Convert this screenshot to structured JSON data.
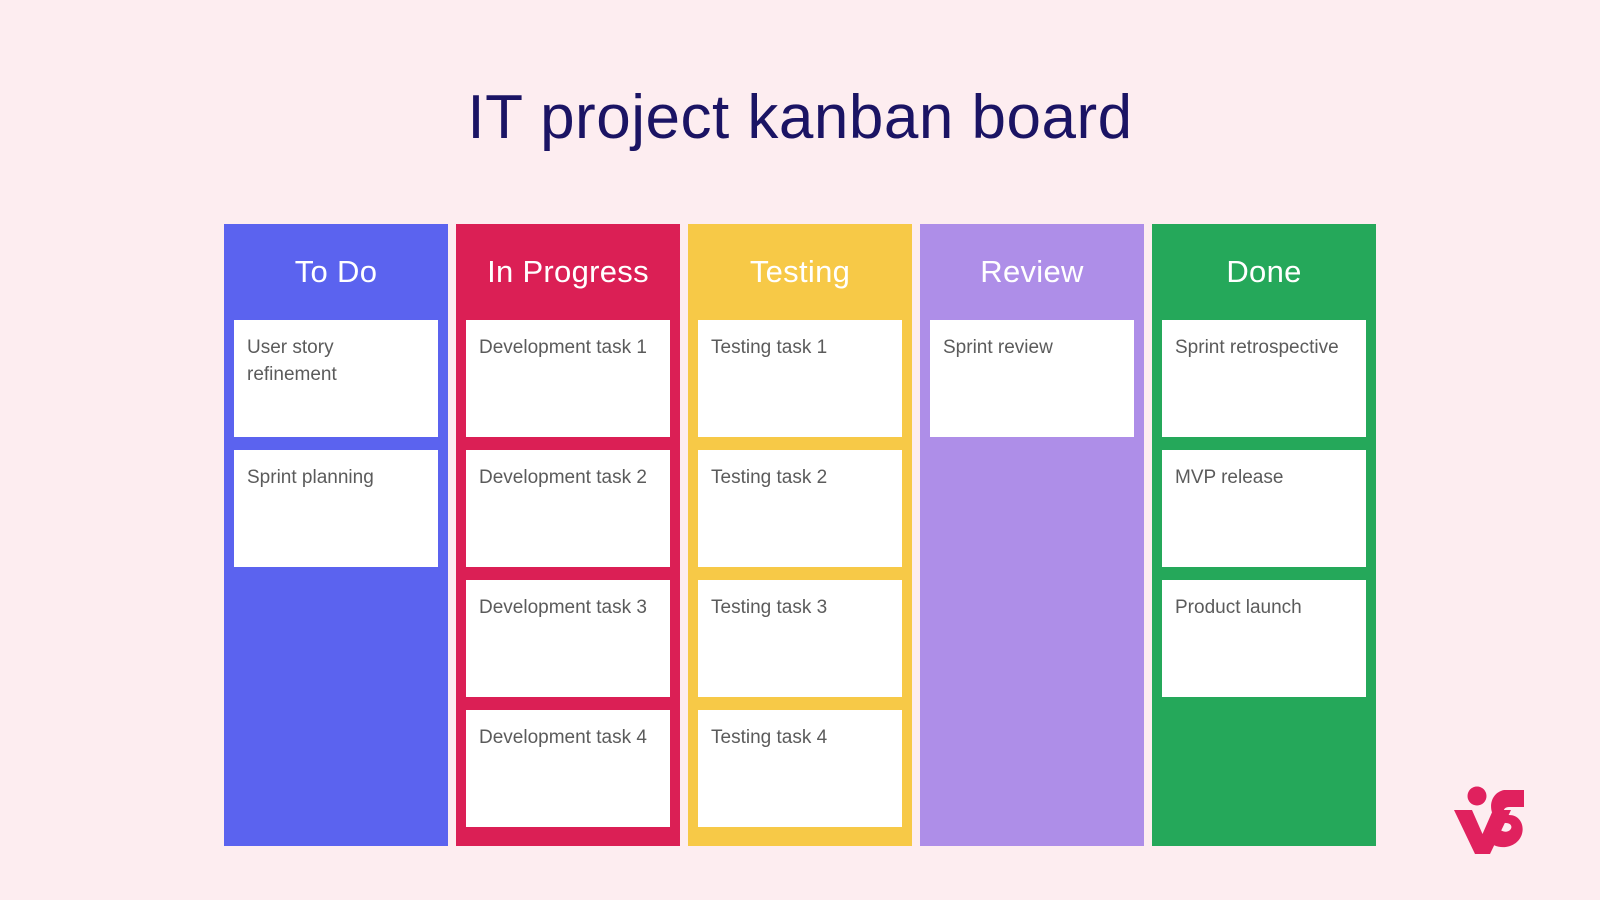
{
  "page": {
    "title": "IT project kanban board",
    "background_color": "#fdedf0",
    "title_color": "#1b1464"
  },
  "board": {
    "columns": [
      {
        "title": "To Do",
        "color": "#5b63ef",
        "cards": [
          {
            "text": "User story refinement"
          },
          {
            "text": "Sprint planning"
          }
        ]
      },
      {
        "title": "In Progress",
        "color": "#db1f55",
        "cards": [
          {
            "text": "Development task 1"
          },
          {
            "text": "Development task 2"
          },
          {
            "text": "Development task 3"
          },
          {
            "text": "Development task 4"
          }
        ]
      },
      {
        "title": "Testing",
        "color": "#f7c947",
        "cards": [
          {
            "text": "Testing task 1"
          },
          {
            "text": "Testing task 2"
          },
          {
            "text": "Testing task 3"
          },
          {
            "text": "Testing task 4"
          }
        ]
      },
      {
        "title": "Review",
        "color": "#ae8ee8",
        "cards": [
          {
            "text": "Sprint review"
          }
        ]
      },
      {
        "title": "Done",
        "color": "#25a85a",
        "cards": [
          {
            "text": "Sprint retrospective"
          },
          {
            "text": "MVP release"
          },
          {
            "text": "Product launch"
          }
        ]
      }
    ]
  },
  "logo": {
    "name": "vs-logo",
    "color": "#e0215e"
  }
}
